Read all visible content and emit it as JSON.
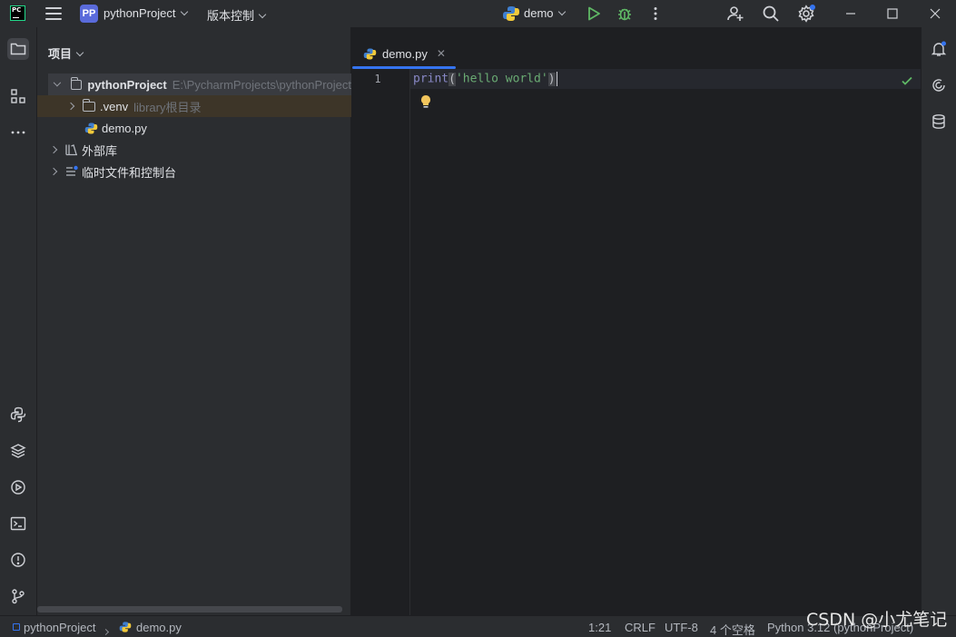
{
  "titlebar": {
    "logo_text": "PC",
    "project_badge": "PP",
    "project_name": "pythonProject",
    "vcs_label": "版本控制",
    "run_config": "demo"
  },
  "project_panel": {
    "title": "项目",
    "tree": [
      {
        "label": "pythonProject",
        "hint": "E:\\PycharmProjects\\pythonProject"
      },
      {
        "label": ".venv",
        "hint": "library根目录"
      },
      {
        "label": "demo.py",
        "hint": ""
      },
      {
        "label": "外部库",
        "hint": ""
      },
      {
        "label": "临时文件和控制台",
        "hint": ""
      }
    ]
  },
  "editor": {
    "tab_label": "demo.py",
    "line_number": "1",
    "code": {
      "fn": "print",
      "open": "(",
      "str": "'hello world'",
      "close": ")"
    }
  },
  "statusbar": {
    "breadcrumb_project": "pythonProject",
    "breadcrumb_file": "demo.py",
    "position": "1:21",
    "line_sep": "CRLF",
    "encoding": "UTF-8",
    "indent": "4 个空格",
    "interpreter": "Python 3.12 (pythonProject)"
  },
  "watermark": "CSDN @小尤笔记",
  "colors": {
    "accent": "#3574f0",
    "run_green": "#5fb865",
    "badge": "#5a6bdb",
    "string": "#6aab73",
    "builtin": "#8888c6"
  }
}
